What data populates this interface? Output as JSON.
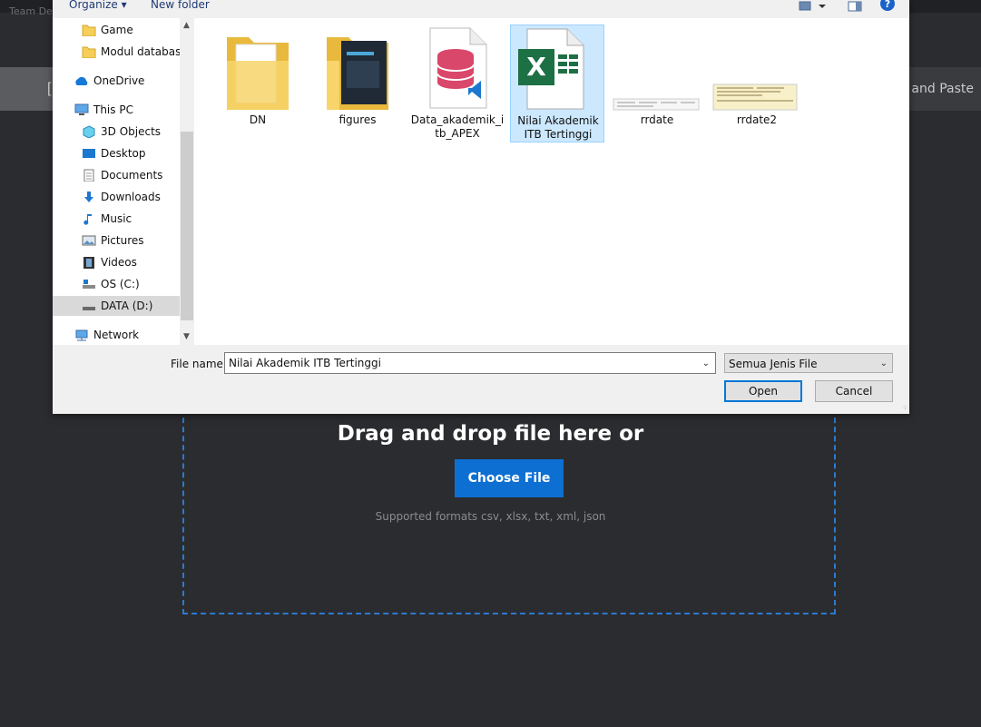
{
  "background": {
    "window_title": "Team De",
    "tab_fragment": "[",
    "paste_label": "y and Paste",
    "drop_title": "Drag and drop file here or",
    "choose_button": "Choose File",
    "formats": "Supported formats csv, xlsx, txt, xml, json",
    "accent": "#0d6fd2"
  },
  "dialog": {
    "toolbar": {
      "organize": "Organize ▾",
      "new_folder": "New folder",
      "help": "?"
    },
    "nav": [
      {
        "label": "Game",
        "icon": "folder-icon"
      },
      {
        "label": "Modul database",
        "icon": "folder-icon"
      },
      {
        "label": "OneDrive",
        "icon": "cloud-icon"
      },
      {
        "label": "This PC",
        "icon": "computer-icon"
      },
      {
        "label": "3D Objects",
        "icon": "cube-icon"
      },
      {
        "label": "Desktop",
        "icon": "desktop-icon"
      },
      {
        "label": "Documents",
        "icon": "document-icon"
      },
      {
        "label": "Downloads",
        "icon": "download-icon"
      },
      {
        "label": "Music",
        "icon": "music-icon"
      },
      {
        "label": "Pictures",
        "icon": "pictures-icon"
      },
      {
        "label": "Videos",
        "icon": "video-icon"
      },
      {
        "label": "OS (C:)",
        "icon": "drive-icon"
      },
      {
        "label": "DATA (D:)",
        "icon": "drive-icon"
      },
      {
        "label": "Network",
        "icon": "network-icon"
      }
    ],
    "files": [
      {
        "name": "DN",
        "type": "folder"
      },
      {
        "name": "figures",
        "type": "folder"
      },
      {
        "name": "Data_akademik_itb_APEX",
        "type": "database"
      },
      {
        "name": "Nilai Akademik ITB Tertinggi",
        "type": "excel"
      },
      {
        "name": "rrdate",
        "type": "image"
      },
      {
        "name": "rrdate2",
        "type": "image"
      }
    ],
    "file_name_label": "File name:",
    "file_name_value": "Nilai Akademik ITB Tertinggi",
    "file_type_value": "Semua Jenis File",
    "open_button": "Open",
    "cancel_button": "Cancel"
  }
}
